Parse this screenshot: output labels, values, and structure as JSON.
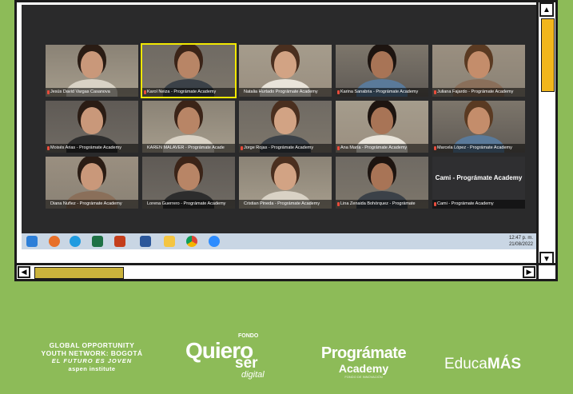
{
  "participants": [
    {
      "name": "Jesús David Vargas Casanova",
      "muted": true
    },
    {
      "name": "Karol Neiza - Prográmate Academy",
      "muted": true,
      "speaking": true
    },
    {
      "name": "Natalia Hurtado Prográmate Academy",
      "muted": false
    },
    {
      "name": "Karina Sanabria - Prográmate Academy",
      "muted": true
    },
    {
      "name": "Juliana Fajardo - Prográmate Academy",
      "muted": true
    },
    {
      "name": "Moisés Arias - Prográmate Academy",
      "muted": true
    },
    {
      "name": "KAREN MALAVER - Prográmate Acade",
      "muted": false
    },
    {
      "name": "Jorge Rojas - Prográmate Academy",
      "muted": true
    },
    {
      "name": "Ana María - Prográmate Academy",
      "muted": true
    },
    {
      "name": "Marcela López - Prográmate Academy",
      "muted": true
    },
    {
      "name": "Diana Nuñez - Prográmate Academy",
      "muted": false
    },
    {
      "name": "Lorena Guerrero - Prográmate Academy",
      "muted": false
    },
    {
      "name": "Cristian Pineda - Prográmate Academy",
      "muted": false
    },
    {
      "name": "Lina Zenaida Bohórquez - Prográmate",
      "muted": true
    },
    {
      "name": "Cami - Prográmate Academy",
      "muted": true,
      "camera_off": true,
      "display": "Cami - Prográmate Academy"
    }
  ],
  "taskbar": {
    "time": "12:47 p. m.",
    "date": "21/08/2022",
    "icons": [
      "windows-start-icon",
      "firefox-icon",
      "edge-icon",
      "excel-icon",
      "powerpoint-icon",
      "word-icon",
      "file-explorer-icon",
      "chrome-icon",
      "zoom-icon"
    ]
  },
  "footer": {
    "gony": {
      "line1": "GLOBAL OPPORTUNITY",
      "line2": "YOUTH NETWORK: BOGOTÁ",
      "tagline": "EL FUTURO ES JOVEN",
      "aspen": "aspen institute"
    },
    "quiero": {
      "fondo": "FONDO",
      "main": "Quiero",
      "ser": "ser",
      "digital": "digital"
    },
    "programate": {
      "line1": "Prográmate",
      "line2": "Academy",
      "small": "FONDO DE INNOVACIÓN"
    },
    "educa": {
      "part1": "Educa",
      "part2": "MÁS"
    }
  },
  "colors": {
    "background": "#8dbb58",
    "accent_scroll": "#f2b61c",
    "speaker_highlight": "#f2e800"
  }
}
